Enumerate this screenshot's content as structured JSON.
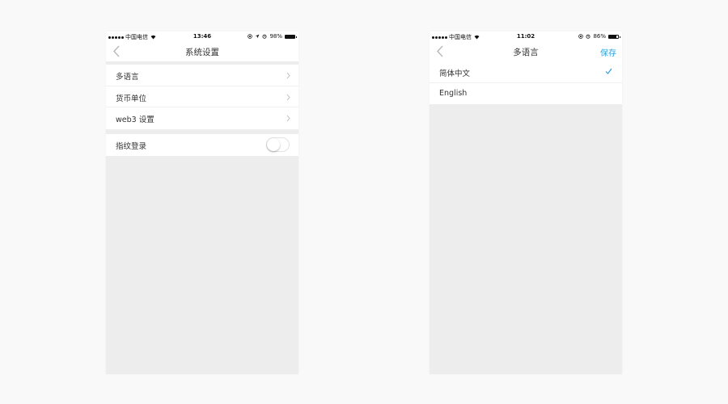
{
  "colors": {
    "page_bg": "#f9f9f9",
    "screen_bg": "#ededed",
    "accent": "#2aa2e0",
    "text": "#333333"
  },
  "settings_screen": {
    "status_bar": {
      "carrier": "中国电信",
      "time": "13:46",
      "battery": "98%",
      "battery_level": 0.98
    },
    "nav": {
      "title": "系统设置",
      "back_icon": "chevron-left-icon"
    },
    "menu_items": [
      {
        "label": "多语言"
      },
      {
        "label": "货币单位"
      },
      {
        "label": "web3 设置"
      }
    ],
    "fingerprint": {
      "label": "指纹登录",
      "enabled": false
    }
  },
  "language_screen": {
    "status_bar": {
      "carrier": "中国电信",
      "time": "11:02",
      "battery": "86%",
      "battery_level": 0.86
    },
    "nav": {
      "title": "多语言",
      "save_label": "保存",
      "back_icon": "chevron-left-icon"
    },
    "options": [
      {
        "label": "简体中文",
        "selected": true
      },
      {
        "label": "English",
        "selected": false
      }
    ]
  }
}
